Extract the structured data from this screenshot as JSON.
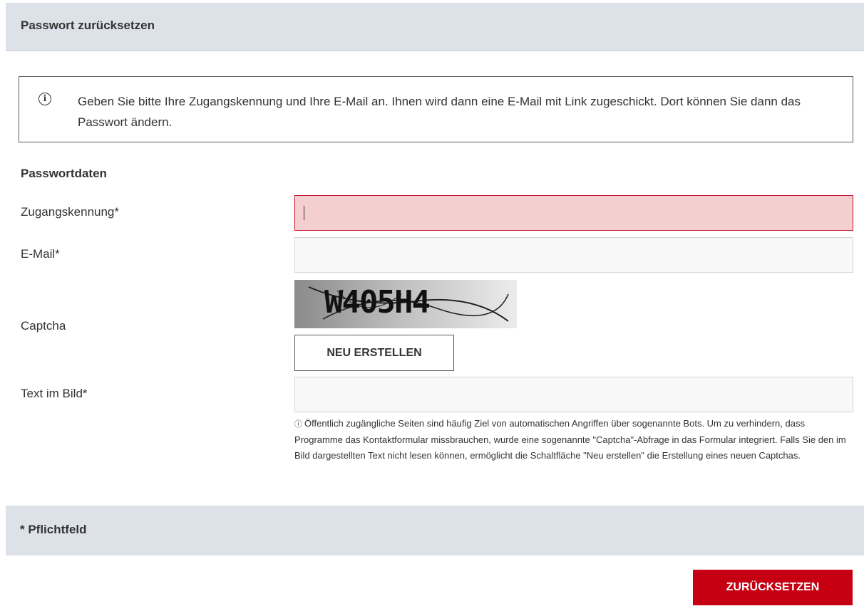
{
  "header": {
    "title": "Passwort zurücksetzen"
  },
  "info": {
    "icon": "info-circle-icon",
    "text": "Geben Sie bitte Ihre Zugangskennung und Ihre E-Mail an. Ihnen wird dann eine E-Mail mit Link zugeschickt. Dort können Sie dann das Passwort ändern."
  },
  "form": {
    "section_title": "Passwortdaten",
    "username_label": "Zugangskennung*",
    "username_value": "",
    "email_label": "E-Mail*",
    "email_value": "",
    "captcha_label": "Captcha",
    "captcha_image_text": "W405H4",
    "regenerate_label": "NEU ERSTELLEN",
    "captcha_input_label": "Text im Bild*",
    "captcha_input_value": "",
    "hint_icon": "info-circle-icon",
    "hint_text": "Öffentlich zugängliche Seiten sind häufig Ziel von automatischen Angriffen über sogenannte Bots. Um zu verhindern, dass Programme das Kontaktformular missbrauchen, wurde eine sogenannte \"Captcha\"-Abfrage in das Formular integriert. Falls Sie den im Bild dargestellten Text nicht lesen können, ermöglicht die Schaltfläche \"Neu erstellen\" die Erstellung eines neuen Captchas."
  },
  "footer": {
    "required_note": "* Pflichtfeld",
    "submit_label": "ZURÜCKSETZEN"
  },
  "colors": {
    "header_bg": "#dde1e8",
    "error_bg": "#f4cfd0",
    "error_border": "#c8102e",
    "primary_button": "#c60012"
  }
}
